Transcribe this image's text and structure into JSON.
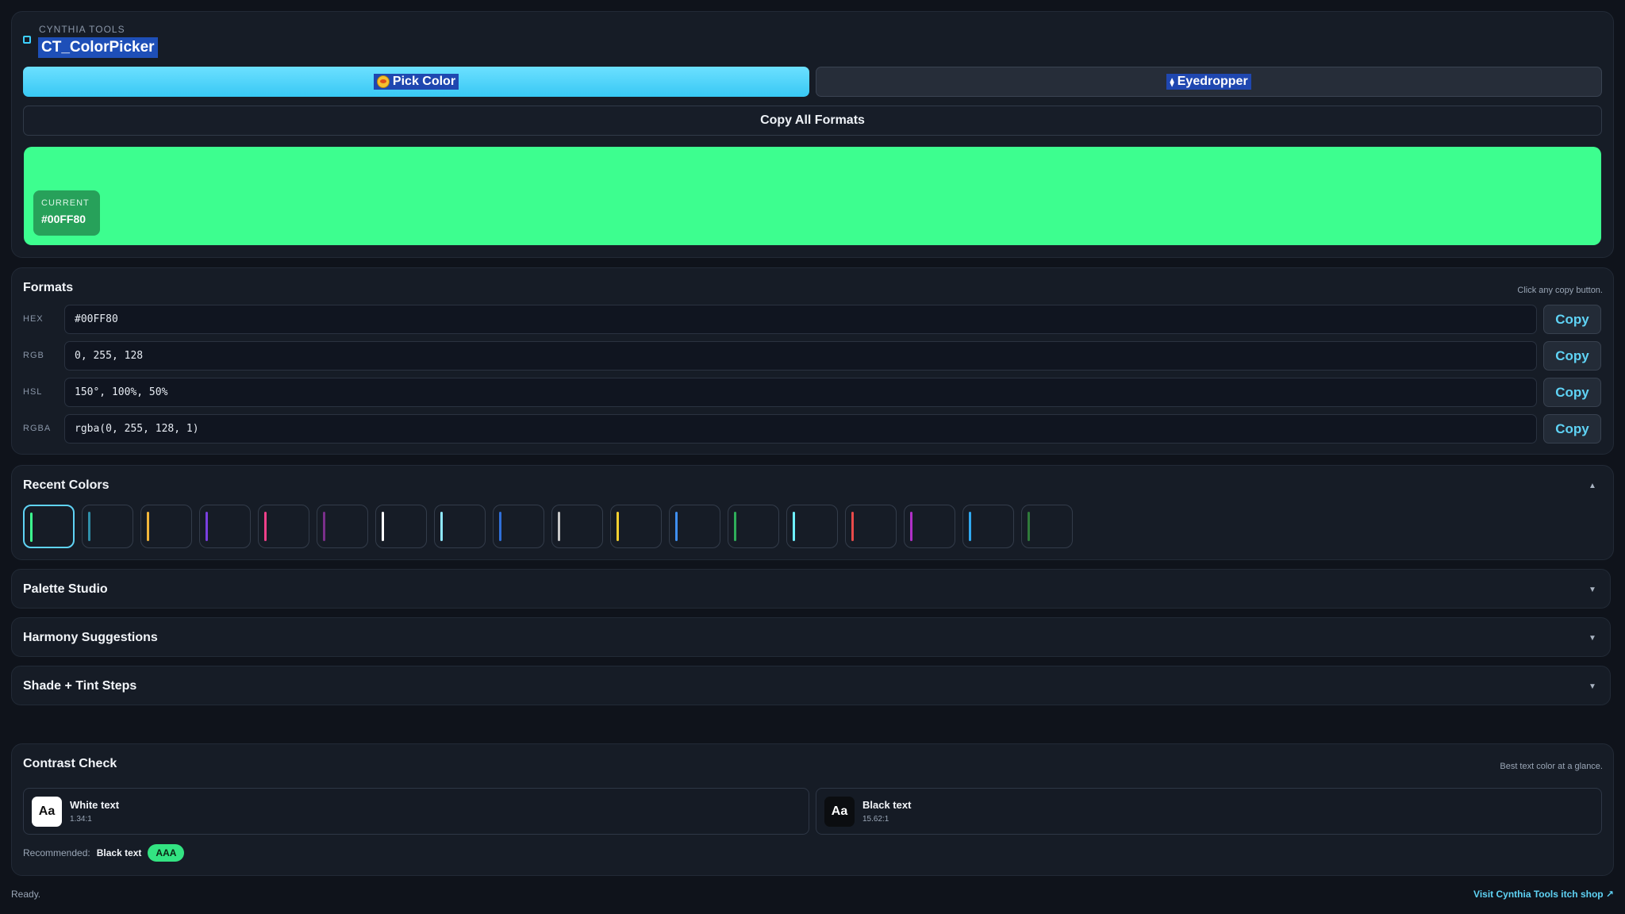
{
  "header": {
    "brand_small": "CYNTHIA TOOLS",
    "title": "CT_ColorPicker"
  },
  "actions": {
    "pick_color": "Pick Color",
    "eyedropper": "Eyedropper",
    "copy_all": "Copy All Formats"
  },
  "current": {
    "label": "CURRENT",
    "hex": "#00FF80",
    "preview_color": "#3dfe8f",
    "chip_color": "#27a15a"
  },
  "formats": {
    "title": "Formats",
    "hint": "Click any copy button.",
    "rows": [
      {
        "label": "HEX",
        "value": "#00FF80",
        "copy": "Copy"
      },
      {
        "label": "RGB",
        "value": "0, 255, 128",
        "copy": "Copy"
      },
      {
        "label": "HSL",
        "value": "150°, 100%, 50%",
        "copy": "Copy"
      },
      {
        "label": "RGBA",
        "value": "rgba(0, 255, 128, 1)",
        "copy": "Copy"
      }
    ]
  },
  "recent": {
    "title": "Recent Colors",
    "swatches": [
      "#3dfe8f",
      "#2f8ea8",
      "#f2b63a",
      "#7a3fe0",
      "#f0408a",
      "#7a2f8a",
      "#ffffff",
      "#8fe8ff",
      "#2f6fd8",
      "#c8c8c8",
      "#f5d030",
      "#3f8ff0",
      "#2fae5a",
      "#6ef0ff",
      "#e84a4a",
      "#b030c8",
      "#30a8f0",
      "#2f7a3a"
    ]
  },
  "accordions": {
    "palette": "Palette Studio",
    "harmony": "Harmony Suggestions",
    "shades": "Shade + Tint Steps"
  },
  "contrast": {
    "title": "Contrast Check",
    "hint": "Best text color at a glance.",
    "white": {
      "sample": "Aa",
      "name": "White text",
      "ratio": "1.34:1"
    },
    "black": {
      "sample": "Aa",
      "name": "Black text",
      "ratio": "15.62:1"
    },
    "recommended_label": "Recommended:",
    "recommended_value": "Black text",
    "grade": "AAA"
  },
  "footer": {
    "status": "Ready.",
    "link": "Visit Cynthia Tools itch shop ↗"
  },
  "icons": {
    "collapse": "▲",
    "expand": "▼",
    "eyedropper_glyph": "⧫"
  },
  "colors": {
    "accent": "#5fd3f5",
    "background": "#0f131b",
    "panel": "#161c26"
  }
}
